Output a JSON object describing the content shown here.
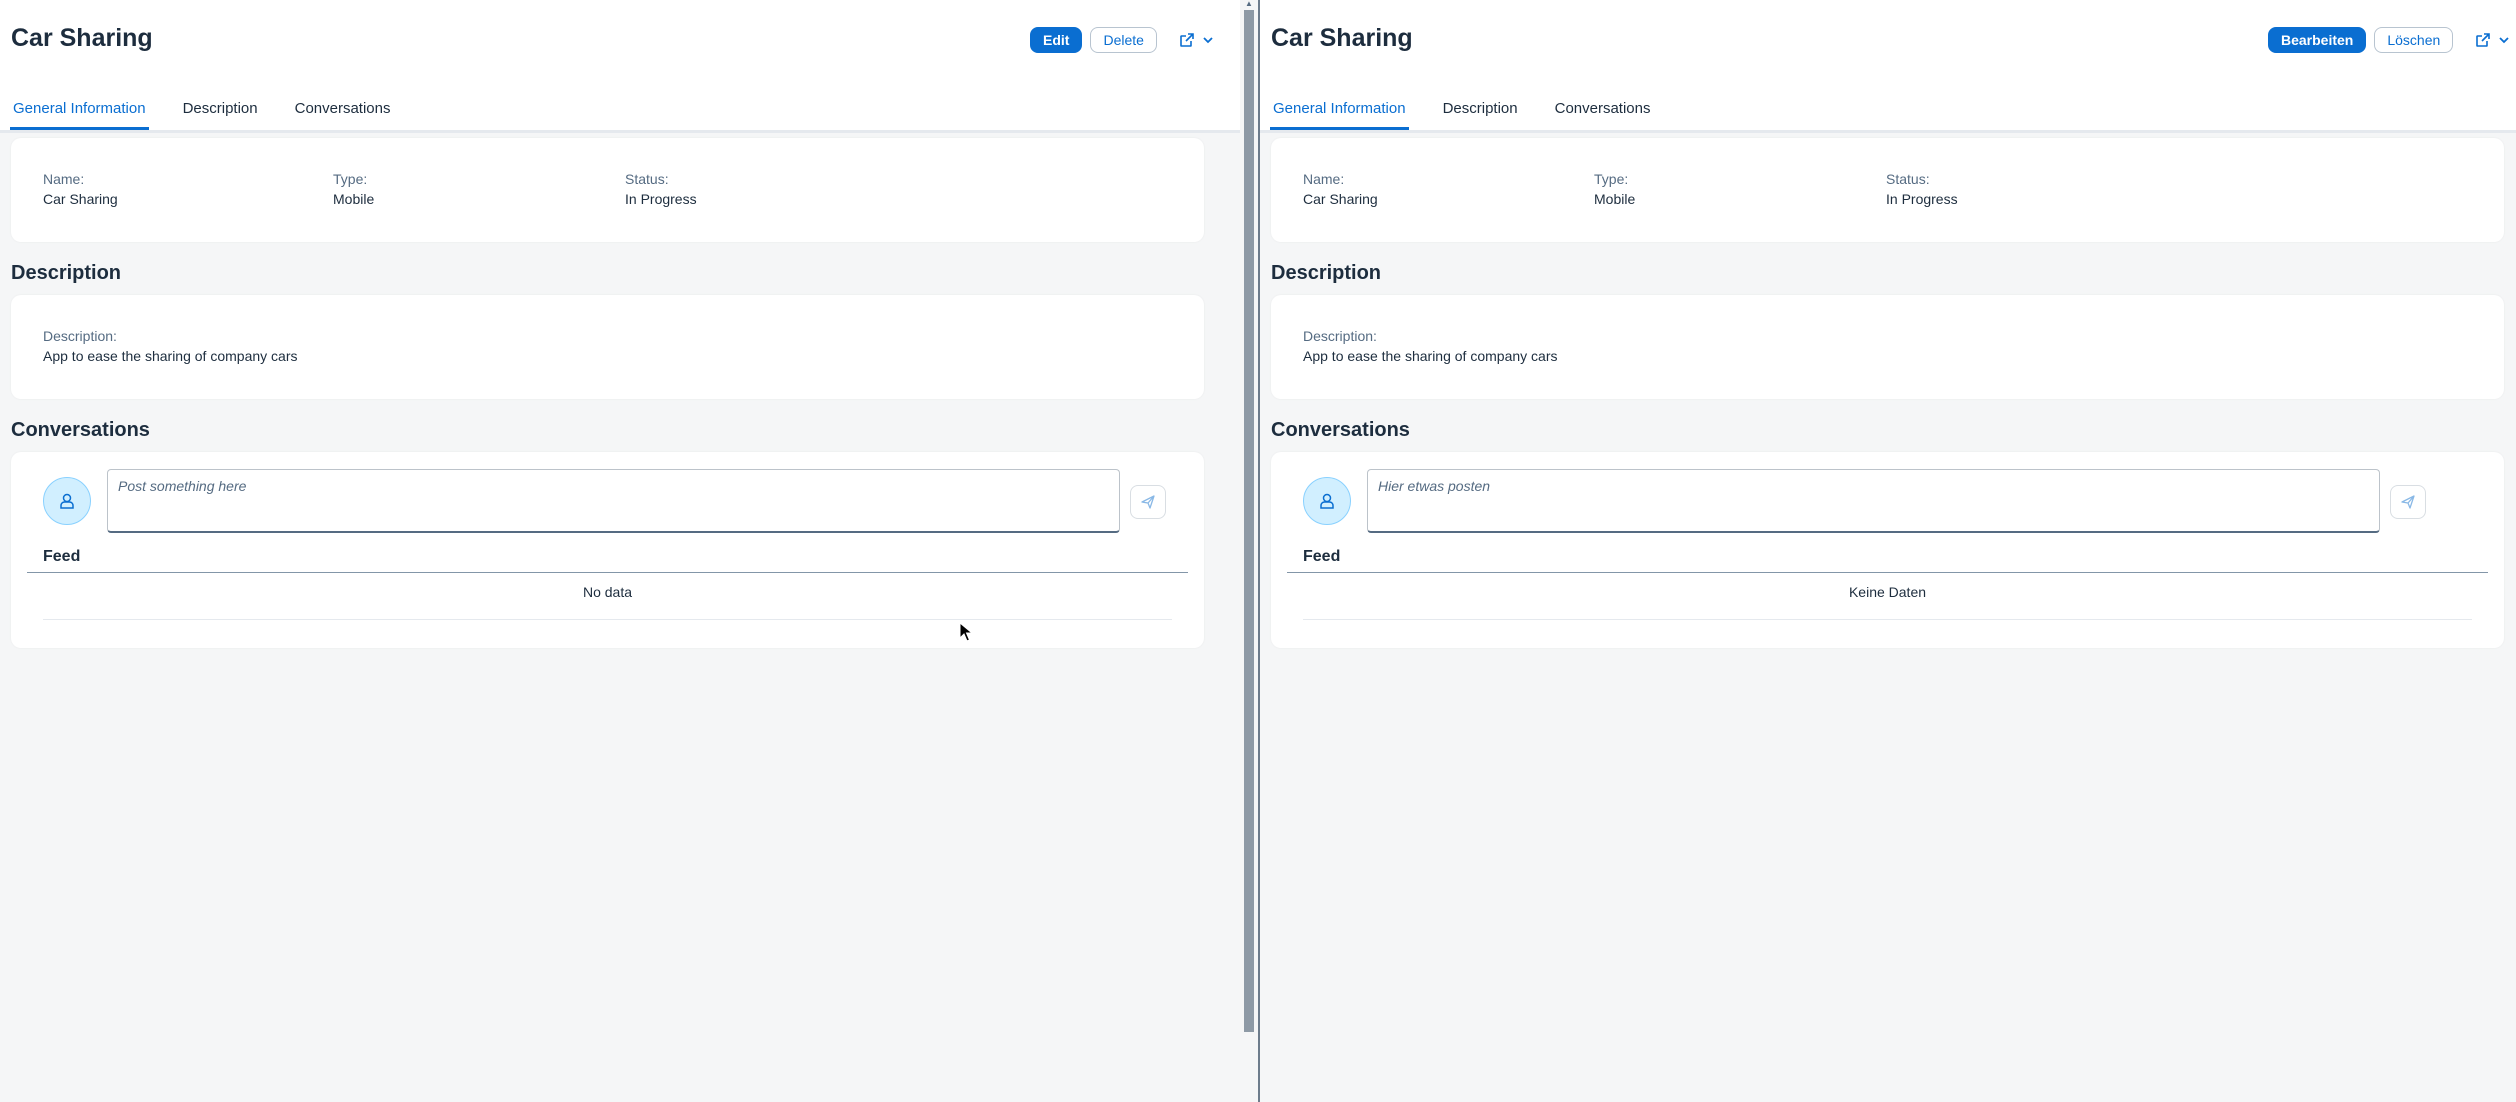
{
  "left": {
    "title": "Car Sharing",
    "actions": {
      "edit": "Edit",
      "delete": "Delete"
    },
    "tabs": [
      "General Information",
      "Description",
      "Conversations"
    ],
    "general": {
      "name_label": "Name:",
      "name_value": "Car Sharing",
      "type_label": "Type:",
      "type_value": "Mobile",
      "status_label": "Status:",
      "status_value": "In Progress"
    },
    "description_section": {
      "title": "Description",
      "label": "Description:",
      "value": "App to ease the sharing of company cars"
    },
    "conversations_section": {
      "title": "Conversations",
      "post_placeholder": "Post something here",
      "feed_title": "Feed",
      "no_data": "No data"
    }
  },
  "right": {
    "title": "Car Sharing",
    "actions": {
      "edit": "Bearbeiten",
      "delete": "Löschen"
    },
    "tabs": [
      "General Information",
      "Description",
      "Conversations"
    ],
    "general": {
      "name_label": "Name:",
      "name_value": "Car Sharing",
      "type_label": "Type:",
      "type_value": "Mobile",
      "status_label": "Status:",
      "status_value": "In Progress"
    },
    "description_section": {
      "title": "Description",
      "label": "Description:",
      "value": "App to ease the sharing of company cars"
    },
    "conversations_section": {
      "title": "Conversations",
      "post_placeholder": "Hier etwas posten",
      "feed_title": "Feed",
      "no_data": "Keine Daten"
    }
  },
  "icons": {
    "share": "share-icon",
    "chevron": "chevron-down-icon",
    "avatar": "person-icon",
    "send": "send-icon"
  },
  "colors": {
    "accent": "#0a6ed1",
    "background": "#f5f6f7",
    "card": "#ffffff",
    "text": "#1d2d3e",
    "label": "#556b82"
  }
}
